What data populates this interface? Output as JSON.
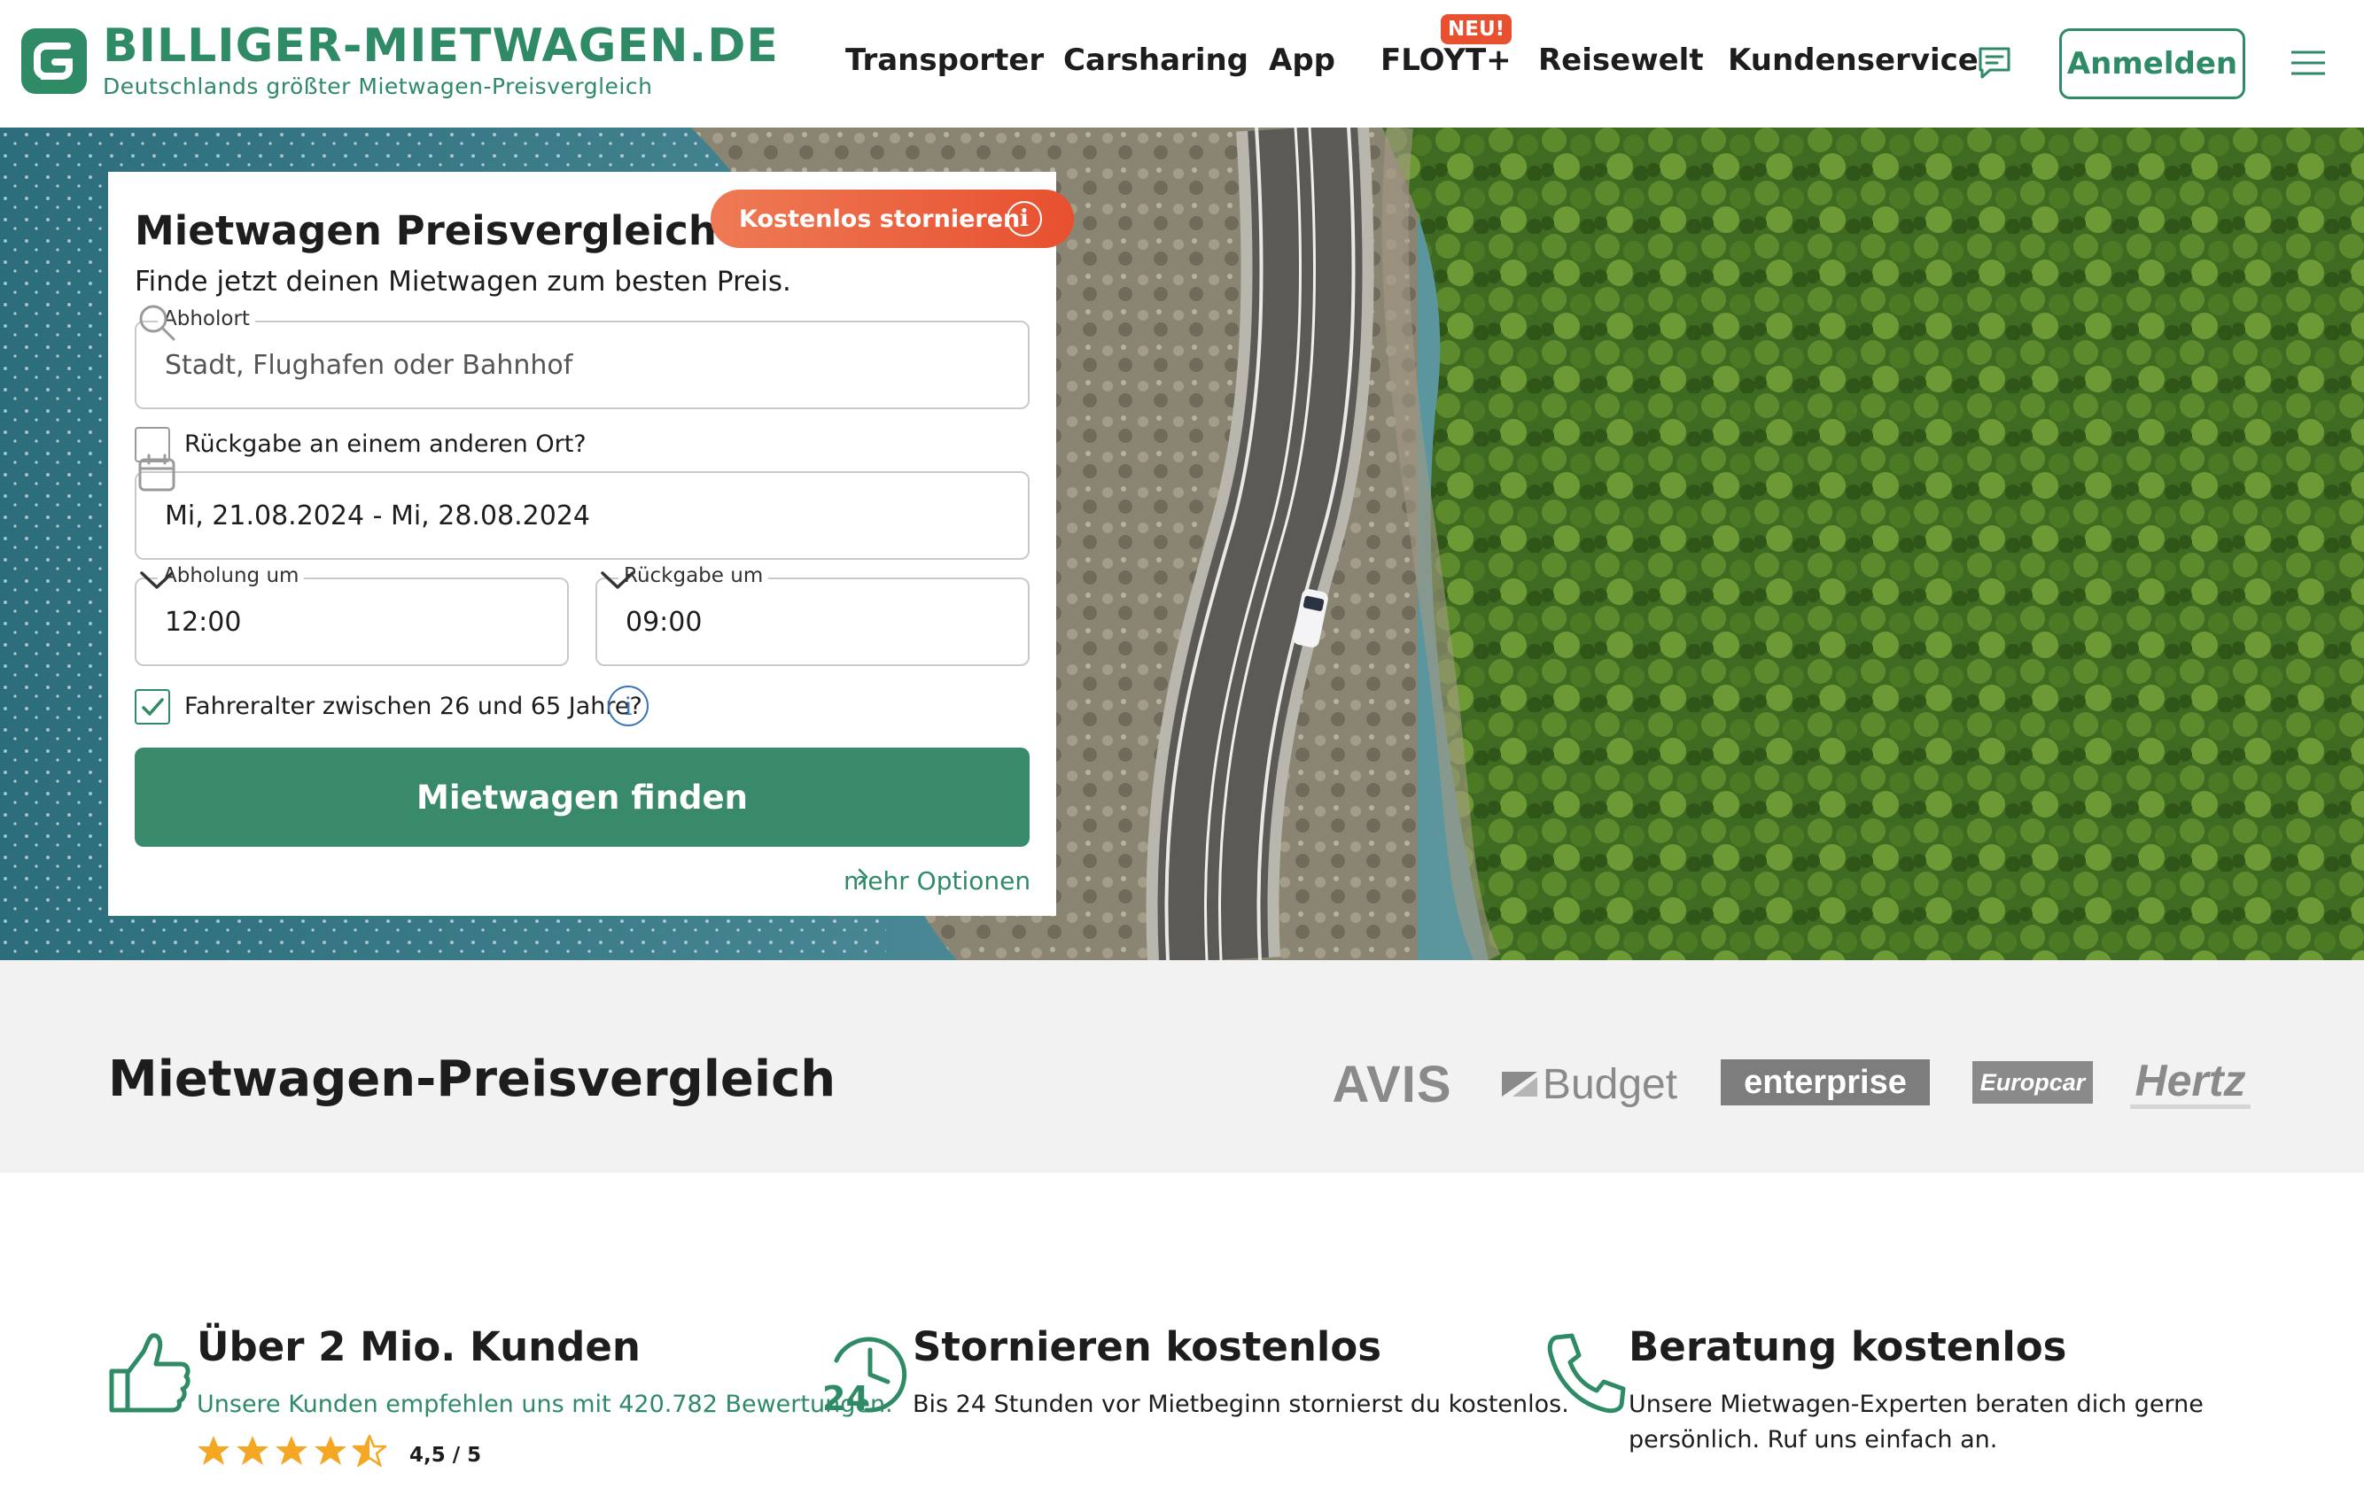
{
  "brand": {
    "name": "BILLIGER-MIETWAGEN.DE",
    "tagline": "Deutschlands größter Mietwagen-Preisvergleich",
    "color": "#2f8a66"
  },
  "nav": {
    "items": [
      "Transporter",
      "Carsharing",
      "App",
      "FLOYT+",
      "Reisewelt",
      "Kundenservice"
    ],
    "badge": "NEU!",
    "login": "Anmelden",
    "icons": [
      "chat-icon",
      "menu-icon"
    ]
  },
  "search": {
    "title": "Mietwagen Preisvergleich",
    "subtitle": "Finde jetzt deinen Mietwagen zum besten Preis.",
    "free_cancel": "Kostenlos stornieren",
    "pickup_label": "Abholort",
    "pickup_placeholder": "Stadt, Flughafen oder Bahnhof",
    "return_other": "Rückgabe an einem anderen Ort?",
    "return_other_checked": false,
    "dates": "Mi, 21.08.2024 - Mi, 28.08.2024",
    "pickup_time_label": "Abholung um",
    "pickup_time": "12:00",
    "return_time_label": "Rückgabe um",
    "return_time": "09:00",
    "driver_age": "Fahreralter zwischen 26 und 65 Jahre?",
    "driver_age_checked": true,
    "submit": "Mietwagen finden",
    "more_options": "mehr Optionen",
    "accent": "#e8502f"
  },
  "providers": {
    "title": "Mietwagen-Preisvergleich",
    "logos": [
      "AVIS",
      "Budget",
      "enterprise",
      "Europcar",
      "Hertz"
    ]
  },
  "features": [
    {
      "title": "Über 2 Mio. Kunden",
      "text": "Unsere Kunden empfehlen uns mit 420.782 Bewertungen.",
      "icon": "thumbs-up-icon",
      "rating": "4,5 / 5",
      "rating_value": 4.5
    },
    {
      "title": "Stornieren kostenlos",
      "text": "Bis 24 Stunden vor Mietbeginn stornierst du kostenlos.",
      "icon": "clock-24-icon",
      "icon_text": "24"
    },
    {
      "title": "Beratung kostenlos",
      "text": "Unsere Mietwagen-Experten beraten dich gerne persönlich. Ruf uns einfach an.",
      "icon": "phone-icon"
    }
  ]
}
